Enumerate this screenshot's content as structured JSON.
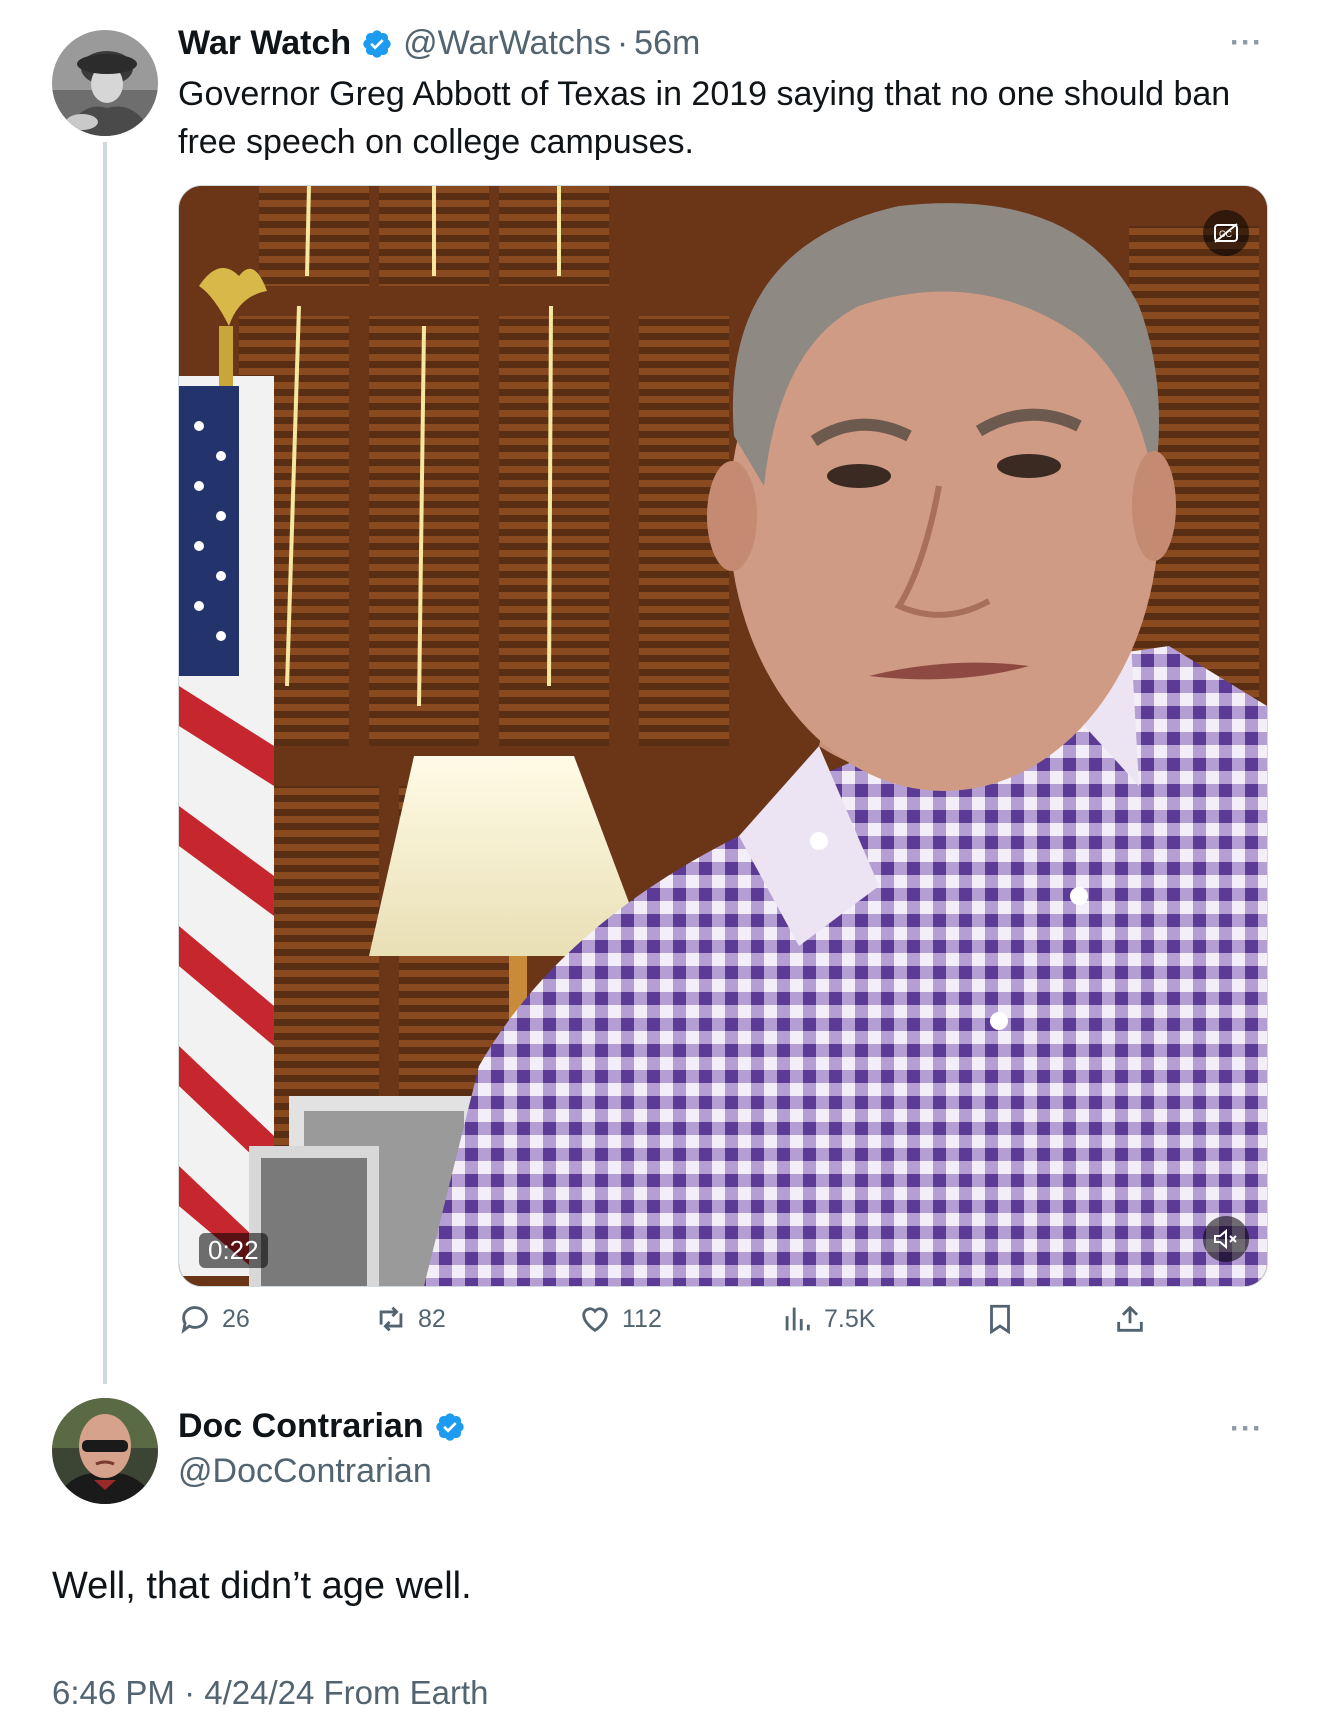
{
  "original_tweet": {
    "display_name": "War Watch",
    "handle": "@WarWatchs",
    "separator": "·",
    "time": "56m",
    "text": "Governor Greg Abbott of Texas in 2019 saying that no one should ban free speech on college campuses.",
    "media": {
      "duration": "0:22",
      "captions_icon": "closed-captions-off-icon",
      "mute_icon": "speaker-muted-icon"
    },
    "actions": {
      "replies": "26",
      "reposts": "82",
      "likes": "112",
      "views": "7.5K"
    }
  },
  "reply_tweet": {
    "display_name": "Doc Contrarian",
    "handle": "@DocContrarian",
    "text": "Well, that didn’t age well.",
    "timestamp": "6:46 PM · 4/24/24 From Earth"
  },
  "more_label": "···",
  "colors": {
    "verified": "#1d9bf0",
    "text_primary": "#0f1419",
    "text_secondary": "#536471",
    "thread_line": "#cfd9de"
  }
}
